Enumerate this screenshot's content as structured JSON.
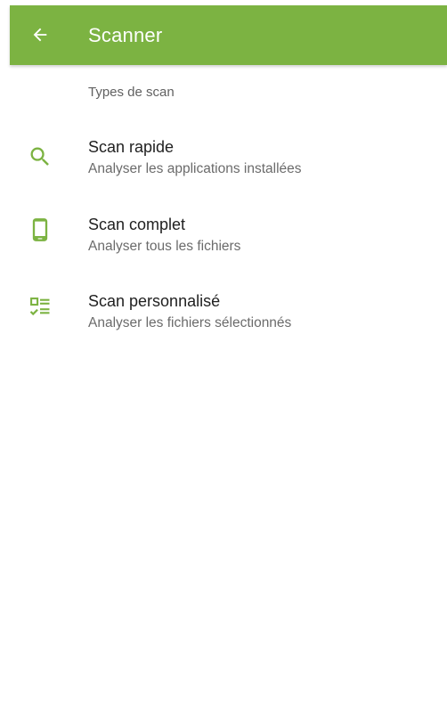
{
  "theme": {
    "toolbar_color": "#7cb342",
    "accent_color": "#7cb342",
    "background": "#ffffff"
  },
  "toolbar": {
    "back_icon": "arrow-left-icon",
    "title": "Scanner"
  },
  "section": {
    "header": "Types de scan"
  },
  "items": [
    {
      "icon": "search-icon",
      "title": "Scan rapide",
      "subtitle": "Analyser les applications installées"
    },
    {
      "icon": "phone-icon",
      "title": "Scan complet",
      "subtitle": "Analyser tous les fichiers"
    },
    {
      "icon": "checklist-icon",
      "title": "Scan personnalisé",
      "subtitle": "Analyser les fichiers sélectionnés"
    }
  ]
}
